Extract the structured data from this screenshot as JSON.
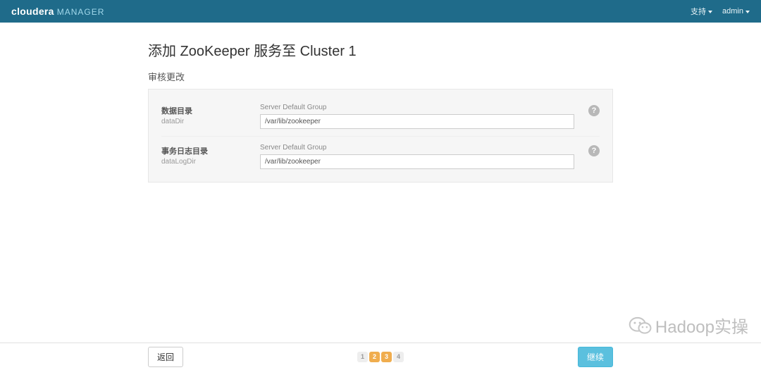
{
  "brand": {
    "main": "cloudera",
    "sub": "MANAGER"
  },
  "nav": {
    "support": "支持",
    "user": "admin"
  },
  "page": {
    "title": "添加 ZooKeeper 服务至 Cluster 1",
    "subtitle": "审核更改"
  },
  "fields": [
    {
      "label": "数据目录",
      "sublabel": "dataDir",
      "group": "Server Default Group",
      "value": "/var/lib/zookeeper"
    },
    {
      "label": "事务日志目录",
      "sublabel": "dataLogDir",
      "group": "Server Default Group",
      "value": "/var/lib/zookeeper"
    }
  ],
  "footer": {
    "back": "返回",
    "continue": "继续"
  },
  "steps": {
    "items": [
      "1",
      "2",
      "3",
      "4"
    ],
    "active_indices": [
      1,
      2
    ]
  },
  "watermark": {
    "text": "Hadoop实操"
  }
}
